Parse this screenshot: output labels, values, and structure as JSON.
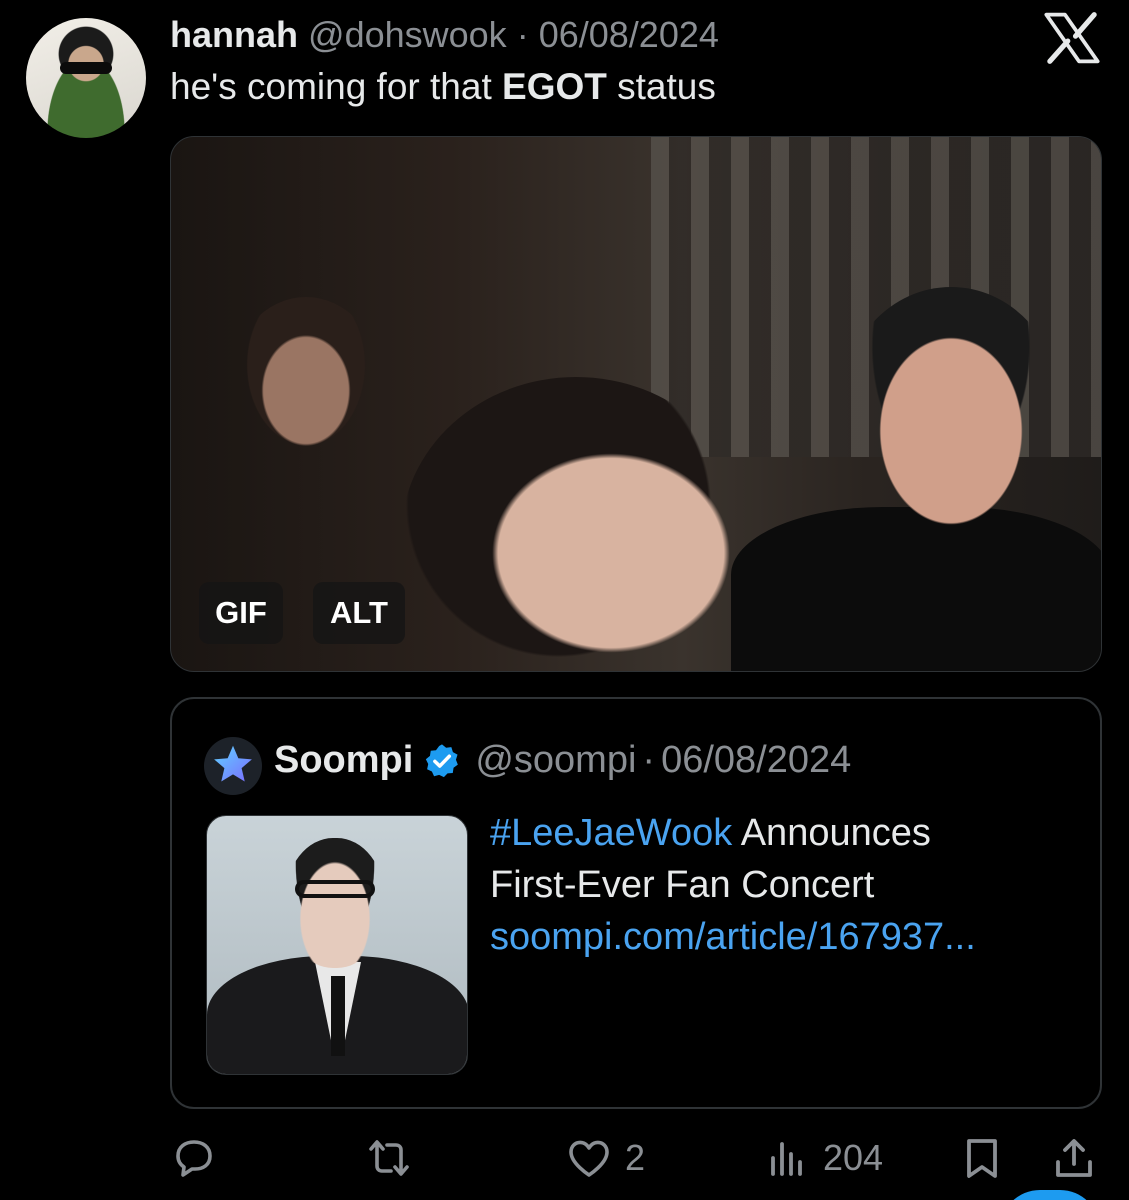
{
  "tweet": {
    "display_name": "hannah",
    "handle": "@dohswook",
    "separator": "·",
    "date": "06/08/2024",
    "text_before": "he's coming for that ",
    "text_bold": "EGOT",
    "text_after": " status",
    "media": {
      "badges": [
        "GIF",
        "ALT"
      ]
    }
  },
  "quote": {
    "display_name": "Soompi",
    "handle": "@soompi",
    "separator": "·",
    "date": "06/08/2024",
    "hashtag": "#LeeJaeWook",
    "text_line1_rest": " Announces",
    "text_line2": "First-Ever Fan Concert",
    "link": "soompi.com/article/167937..."
  },
  "actions": {
    "reply_count": "",
    "retweet_count": "",
    "like_count": "2",
    "views_count": "204"
  },
  "icons": {
    "app_logo": "x-logo-icon",
    "reply": "reply-icon",
    "retweet": "retweet-icon",
    "like": "heart-icon",
    "views": "views-icon",
    "bookmark": "bookmark-icon",
    "share": "share-icon",
    "verified": "verified-badge-icon"
  },
  "colors": {
    "background": "#000000",
    "text": "#e7e9ea",
    "secondary": "#8b8f94",
    "link": "#4aa3f0",
    "border": "#2f3336",
    "accent": "#1d9bf0"
  }
}
